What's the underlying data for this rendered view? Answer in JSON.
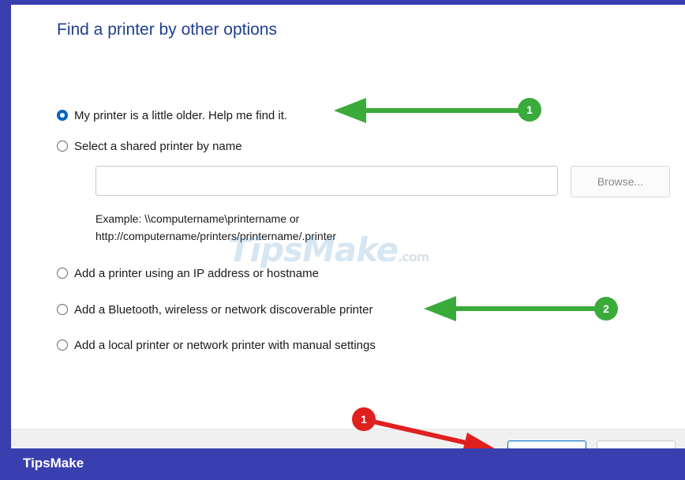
{
  "dialog": {
    "title": "Find a printer by other options",
    "options": [
      {
        "label": "My printer is a little older. Help me find it.",
        "selected": true
      },
      {
        "label": "Select a shared printer by name",
        "selected": false
      },
      {
        "label": "Add a printer using an IP address or hostname",
        "selected": false
      },
      {
        "label": "Add a Bluetooth, wireless or network discoverable printer",
        "selected": false
      },
      {
        "label": "Add a local printer or network printer with manual settings",
        "selected": false
      }
    ],
    "shared_printer_input": {
      "value": "",
      "placeholder": ""
    },
    "browse_label": "Browse...",
    "example_line1": "Example: \\\\computername\\printername or",
    "example_line2": "http://computername/printers/printername/.printer"
  },
  "annotations": {
    "badge_1": "1",
    "badge_2": "2",
    "badge_red": "1",
    "arrow_green": "#3aaa3a",
    "arrow_red": "#e01f1f"
  },
  "watermark": {
    "text": "TipsMake",
    "domain": ".com"
  },
  "brand_bar": {
    "label": "TipsMake",
    "color": "#3a3fb0"
  }
}
